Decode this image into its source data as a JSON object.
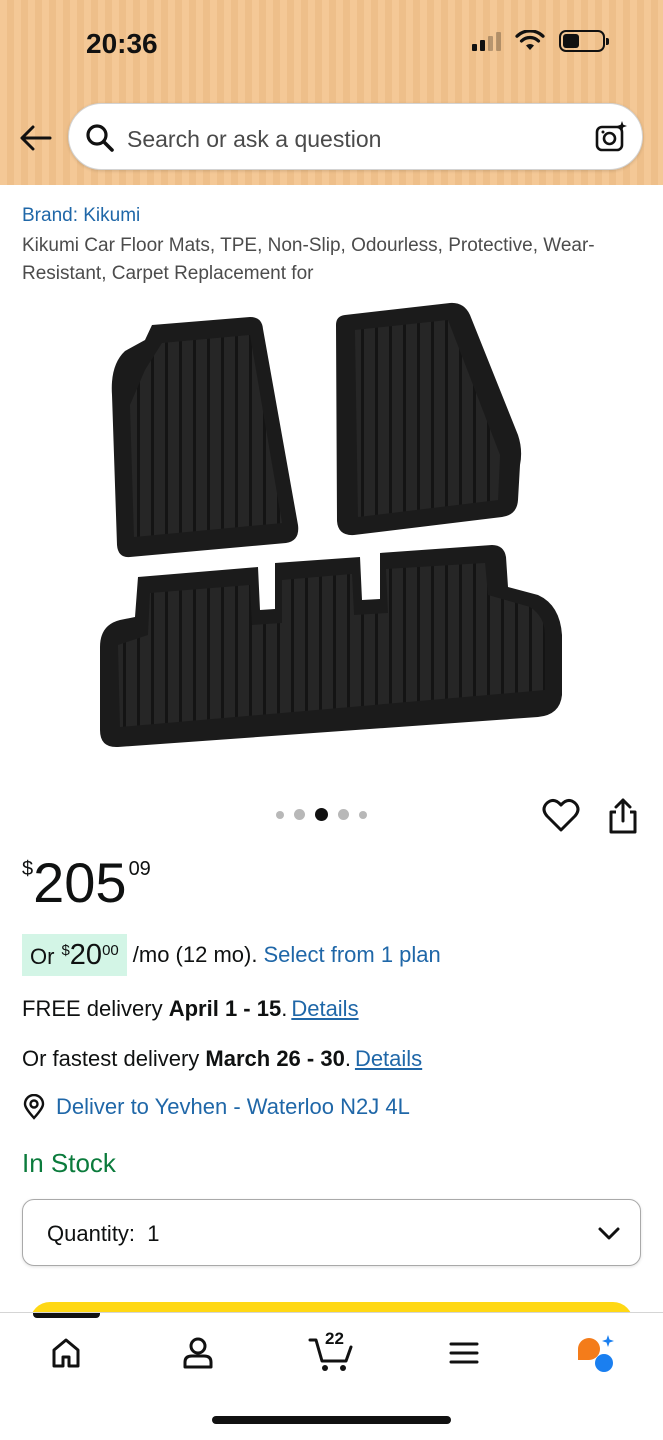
{
  "status_bar": {
    "time": "20:36"
  },
  "search": {
    "placeholder": "Search or ask a question"
  },
  "product": {
    "brand": "Brand: Kikumi",
    "title": "Kikumi Car Floor Mats, TPE, Non-Slip, Odourless, Protective, Wear-Resistant, Carpet Replacement for",
    "image_icon": "car-floor-mats-image",
    "carousel": {
      "total": 5,
      "active_index": 2
    }
  },
  "price": {
    "currency": "$",
    "whole": "205",
    "fraction": "09"
  },
  "installment": {
    "prefix": "Or",
    "currency": "$",
    "whole": "20",
    "fraction": "00",
    "suffix": "/mo (12 mo).",
    "link": "Select from 1 plan"
  },
  "delivery": {
    "free_prefix": "FREE delivery",
    "free_dates": "April 1 - 15",
    "fast_prefix": "Or fastest delivery",
    "fast_dates": "March 26 - 30",
    "details_label": "Details",
    "location": "Deliver to Yevhen - Waterloo N2J 4L"
  },
  "stock": "In Stock",
  "quantity": {
    "label": "Quantity:",
    "value": "1"
  },
  "nav": {
    "items": [
      "home-icon",
      "account-icon",
      "cart-icon",
      "menu-icon",
      "rufus-assistant-icon"
    ],
    "cart_count": "22"
  },
  "colors": {
    "link": "#1f67a8",
    "in_stock": "#0b7b3c",
    "installment_highlight": "#d3f5e6",
    "buy_button": "#ffd814",
    "header": "#f4c896"
  }
}
